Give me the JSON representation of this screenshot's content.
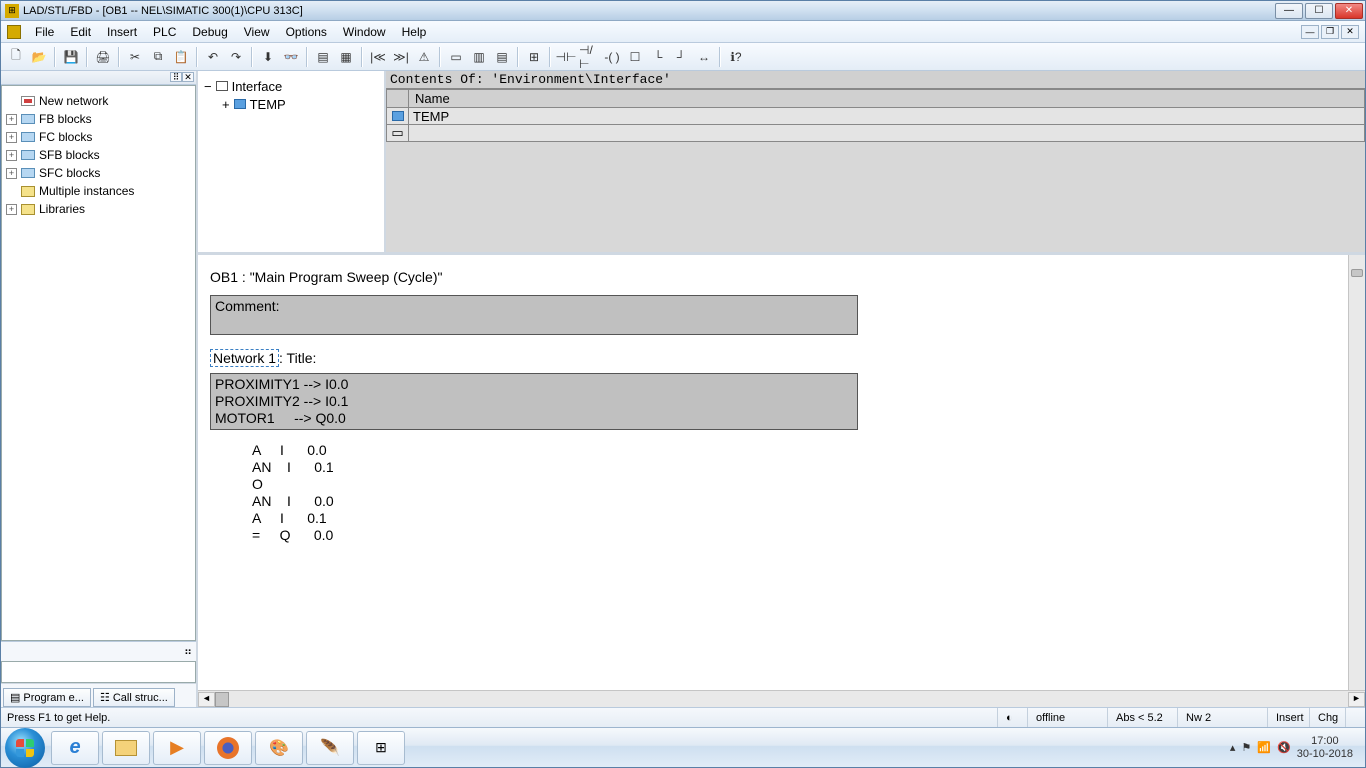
{
  "titlebar": {
    "title": "LAD/STL/FBD  - [OB1 -- NEL\\SIMATIC 300(1)\\CPU 313C]"
  },
  "menubar": {
    "items": [
      "File",
      "Edit",
      "Insert",
      "PLC",
      "Debug",
      "View",
      "Options",
      "Window",
      "Help"
    ]
  },
  "left_tree": {
    "items": [
      {
        "label": "New network",
        "icon": "net"
      },
      {
        "label": "FB blocks",
        "icon": "block",
        "expandable": true
      },
      {
        "label": "FC blocks",
        "icon": "block",
        "expandable": true
      },
      {
        "label": "SFB blocks",
        "icon": "block",
        "expandable": true
      },
      {
        "label": "SFC blocks",
        "icon": "block",
        "expandable": true
      },
      {
        "label": "Multiple instances",
        "icon": "lib"
      },
      {
        "label": "Libraries",
        "icon": "lib",
        "expandable": true
      }
    ],
    "tabs": [
      "Program e...",
      "Call struc..."
    ]
  },
  "interface_left": {
    "root": "Interface",
    "child": "TEMP"
  },
  "interface_right": {
    "header": "Contents Of: 'Environment\\Interface'",
    "col": "Name",
    "rows": [
      "TEMP",
      ""
    ]
  },
  "editor": {
    "ob_label": "OB1 : ",
    "ob_title": "\"Main Program Sweep (Cycle)\"",
    "comment_label": "Comment:",
    "network_label": "Network 1",
    "title_label": ": Title:",
    "varmap": "PROXIMITY1 --> I0.0\nPROXIMITY2 --> I0.1\nMOTOR1     --> Q0.0",
    "stl": "A     I      0.0\nAN    I      0.1\nO     \nAN    I      0.0\nA     I      0.1\n=     Q      0.0"
  },
  "statusbar": {
    "help": "Press F1 to get Help.",
    "mode": "offline",
    "abs": "Abs < 5.2",
    "nw": "Nw 2",
    "ins": "Insert",
    "chg": "Chg"
  },
  "taskbar": {
    "time": "17:00",
    "date": "30-10-2018"
  }
}
